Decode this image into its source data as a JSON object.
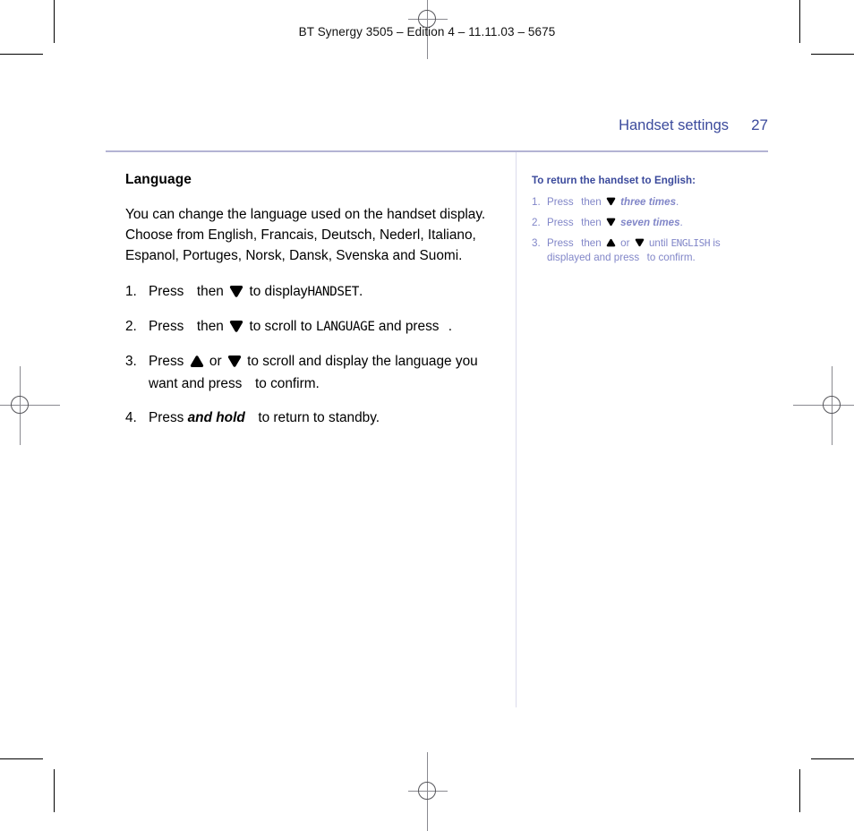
{
  "running_head": "BT Synergy 3505 – Edition 4 – 11.11.03 – 5675",
  "header": {
    "title": "Handset settings",
    "page_number": "27",
    "color": "#3b4a9c"
  },
  "colors": {
    "heading_blue": "#3b4a9c",
    "sidebar_text": "#8186c8",
    "rule": "#b3b3d4",
    "divider": "#dcdcec"
  },
  "main": {
    "section_heading": "Language",
    "intro": "You can change the language used on the handset display. Choose from English, Francais, Deutsch, Nederl, Italiano, Espanol, Portuges, Norsk, Dansk, Svenska and Suomi.",
    "steps": [
      {
        "num": "1.",
        "t1": "Press",
        "icon1": "ok-key-icon",
        "t2": "then",
        "icon2": "down-arrow-icon",
        "t3": "to display",
        "lcd": "HANDSET",
        "t4": "."
      },
      {
        "num": "2.",
        "t1": "Press",
        "icon1": "ok-key-icon",
        "t2": "then",
        "icon2": "down-arrow-icon",
        "t3": "to scroll to",
        "lcd": "LANGUAGE",
        "t4": "and press",
        "icon3": "ok-key-icon",
        "t5": "."
      },
      {
        "num": "3.",
        "t1": "Press",
        "icon1": "up-arrow-icon",
        "t2": "or",
        "icon2": "down-arrow-icon",
        "t3": "to scroll and display the language you want and press",
        "icon3": "ok-key-icon",
        "t4": "to confirm."
      },
      {
        "num": "4.",
        "t1": "Press",
        "emphasis": "and hold",
        "icon1": "cancel-key-icon",
        "t2": "to return to standby."
      }
    ]
  },
  "sidebar": {
    "heading": "To return the handset to English:",
    "steps": [
      {
        "num": "1.",
        "t1": "Press",
        "icon1": "ok-key-icon",
        "t2": "then",
        "icon2": "down-arrow-icon",
        "emphasis": "three times",
        "t3": "."
      },
      {
        "num": "2.",
        "t1": "Press",
        "icon1": "ok-key-icon",
        "t2": "then",
        "icon2": "down-arrow-icon",
        "emphasis": "seven times",
        "t3": "."
      },
      {
        "num": "3.",
        "t1": "Press",
        "icon1": "ok-key-icon",
        "t2": "then",
        "icon2": "up-arrow-icon",
        "t3": "or",
        "icon3": "down-arrow-icon",
        "t4": "until",
        "lcd": "ENGLISH",
        "t5": "is displayed and press",
        "icon4": "ok-key-icon",
        "t6": "to confirm."
      }
    ]
  },
  "print_marks": {
    "check_glyph": "✔",
    "cancel_glyph": "✘"
  }
}
